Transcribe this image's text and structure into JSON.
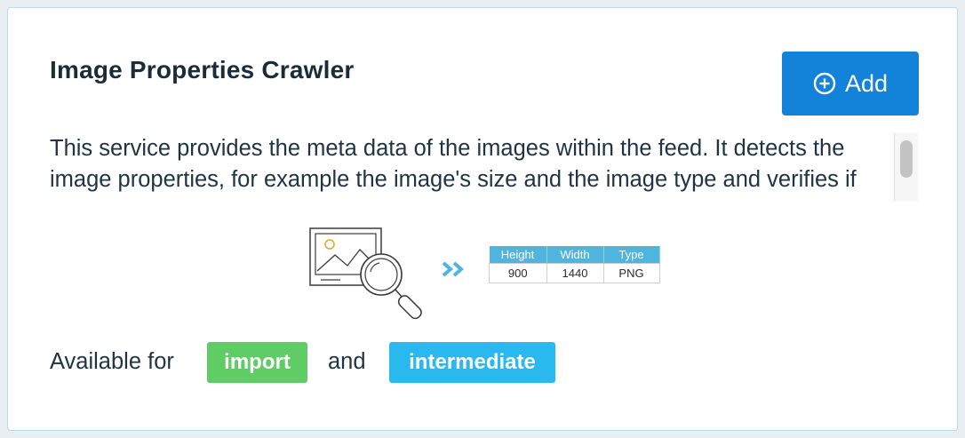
{
  "card": {
    "title": "Image Properties Crawler",
    "add_button": {
      "label": "Add",
      "icon": "plus-circle-icon",
      "color": "#1283d8"
    },
    "description": "This service provides the meta data of the images within the feed. It detects the image properties, for example the image's size and the image type and verifies if the",
    "illustration": {
      "icon": "image-magnifier-icon",
      "arrow_icon": "double-chevron-right-icon",
      "table": {
        "headers": [
          "Height",
          "Width",
          "Type"
        ],
        "row": [
          "900",
          "1440",
          "PNG"
        ]
      }
    },
    "availability": {
      "prefix": "Available for",
      "connector": "and",
      "tags": [
        {
          "label": "import",
          "color": "#5fcc66"
        },
        {
          "label": "intermediate",
          "color": "#2ab9ef"
        }
      ]
    }
  }
}
